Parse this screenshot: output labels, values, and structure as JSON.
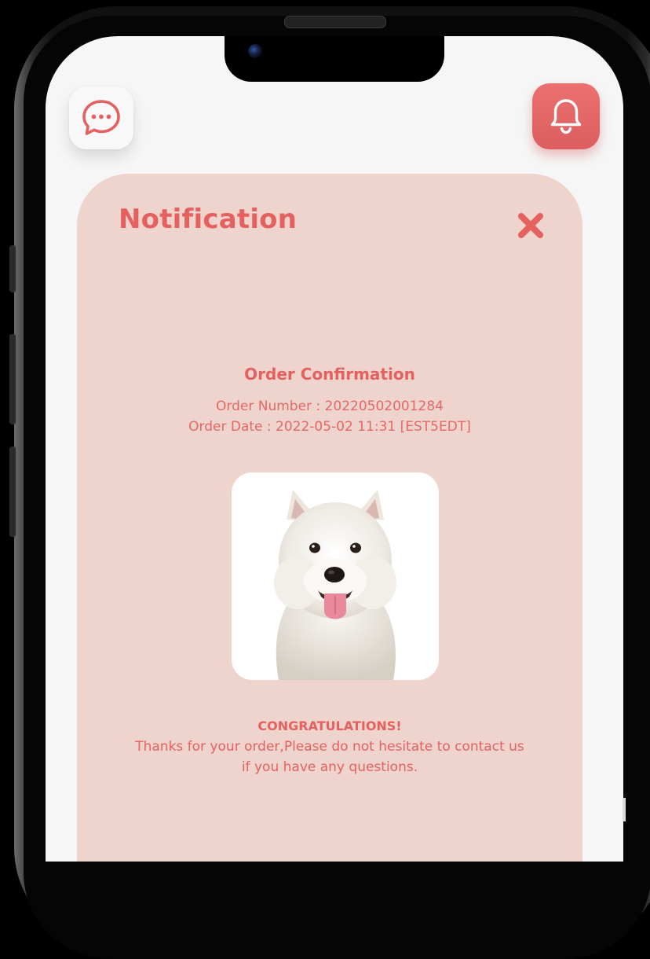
{
  "header": {
    "chat_icon": "chat-bubble-dots-icon",
    "notification_icon": "bell-icon"
  },
  "notification": {
    "title": "Notification",
    "close_icon": "close-x-icon",
    "order_title": "Order Confirmation",
    "order_number": "Order Number : 20220502001284",
    "order_date": "Order Date : 2022-05-02 11:31 [EST5EDT]",
    "image_subject": "west-highland-terrier-dog",
    "congrats": "CONGRATULATIONS!",
    "thanks_line1": "Thanks for your order,Please do not hesitate to contact us",
    "thanks_line2": "if you have any questions."
  },
  "colors": {
    "accent": "#e5615f",
    "card_background": "#efd4ce",
    "screen_background": "#f6f6f6",
    "bell_button": "#e36667"
  }
}
